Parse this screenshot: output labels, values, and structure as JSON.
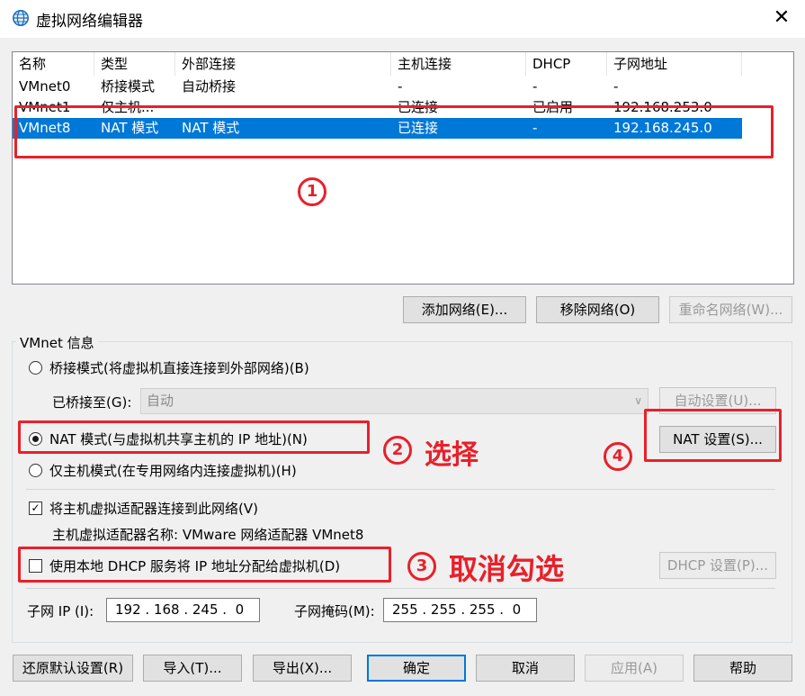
{
  "window": {
    "title": "虚拟网络编辑器",
    "close_glyph": "✕"
  },
  "table": {
    "headers": [
      "名称",
      "类型",
      "外部连接",
      "主机连接",
      "DHCP",
      "子网地址"
    ],
    "rows": [
      [
        "VMnet0",
        "桥接模式",
        "自动桥接",
        "-",
        "-",
        "-"
      ],
      [
        "VMnet1",
        "仅主机...",
        "",
        "已连接",
        "已启用",
        "192.168.253.0"
      ],
      [
        "VMnet8",
        "NAT 模式",
        "NAT 模式",
        "已连接",
        "-",
        "192.168.245.0"
      ]
    ]
  },
  "list_buttons": {
    "add": "添加网络(E)...",
    "remove": "移除网络(O)",
    "rename": "重命名网络(W)..."
  },
  "vmnet_info": {
    "group_label": "VMnet 信息",
    "bridge_radio": "桥接模式(将虚拟机直接连接到外部网络)(B)",
    "bridged_to_label": "已桥接至(G):",
    "bridged_to_value": "自动",
    "auto_settings": "自动设置(U)...",
    "nat_radio": "NAT 模式(与虚拟机共享主机的 IP 地址)(N)",
    "nat_settings": "NAT 设置(S)...",
    "host_only_radio": "仅主机模式(在专用网络内连接虚拟机)(H)",
    "connect_adapter_check": "将主机虚拟适配器连接到此网络(V)",
    "adapter_name_text": "主机虚拟适配器名称: VMware 网络适配器 VMnet8",
    "dhcp_check": "使用本地 DHCP 服务将 IP 地址分配给虚拟机(D)",
    "dhcp_settings": "DHCP 设置(P)...",
    "subnet_ip_label": "子网 IP (I):",
    "subnet_ip_value": "192 . 168 . 245 .  0",
    "subnet_mask_label": "子网掩码(M):",
    "subnet_mask_value": "255 . 255 . 255 .  0"
  },
  "bottom_buttons": {
    "restore": "还原默认设置(R)",
    "import": "导入(T)...",
    "export": "导出(X)...",
    "ok": "确定",
    "cancel": "取消",
    "apply": "应用(A)",
    "help": "帮助"
  },
  "annotations": {
    "n1": "1",
    "n2": "2",
    "n3": "3",
    "n4": "4",
    "select_text": "选择",
    "uncheck_text": "取消勾选",
    "color": "#e8202a"
  },
  "colors": {
    "selection": "#0078d7",
    "window_bg": "#f0f0f0"
  }
}
